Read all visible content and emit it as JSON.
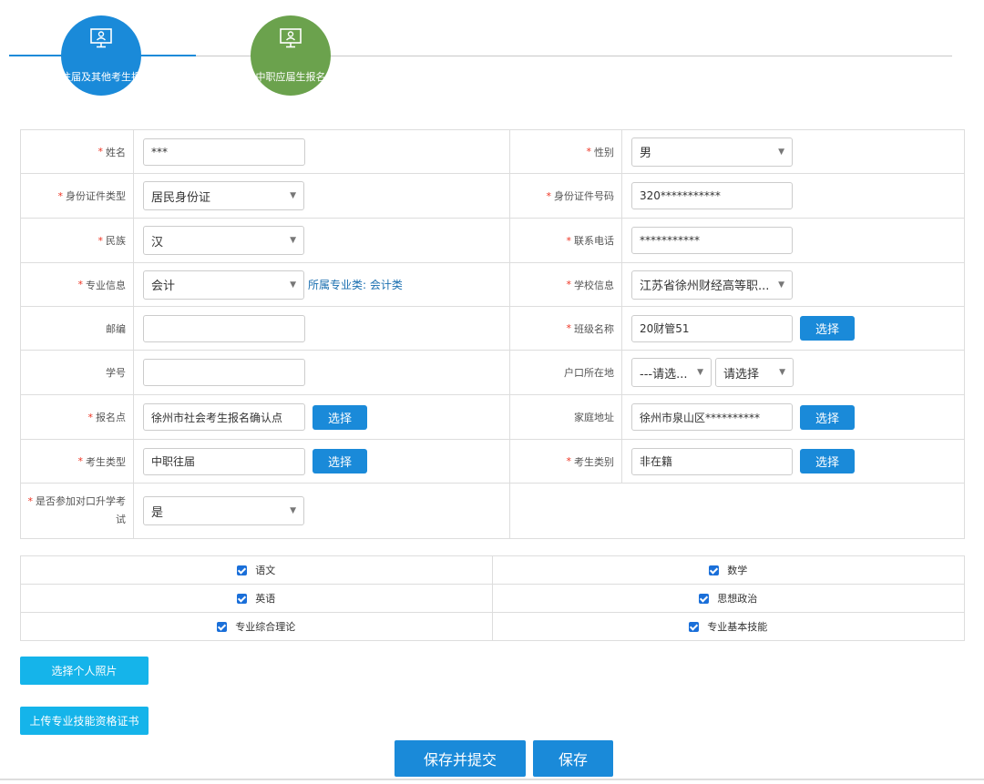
{
  "steps": [
    {
      "label": "往届及其他考生报"
    },
    {
      "label": "中职应届生报名"
    }
  ],
  "form": {
    "name": {
      "label": "姓名",
      "value": "***"
    },
    "gender": {
      "label": "性别",
      "value": "男"
    },
    "id_type": {
      "label": "身份证件类型",
      "value": "居民身份证"
    },
    "id_number": {
      "label": "身份证件号码",
      "value": "320***********"
    },
    "ethnicity": {
      "label": "民族",
      "value": "汉"
    },
    "phone": {
      "label": "联系电话",
      "value": "***********"
    },
    "major": {
      "label": "专业信息",
      "value": "会计",
      "category": "所属专业类: 会计类"
    },
    "school": {
      "label": "学校信息",
      "value": "江苏省徐州财经高等职..."
    },
    "postcode": {
      "label": "邮编",
      "value": ""
    },
    "class_name": {
      "label": "班级名称",
      "value": "20财管51",
      "button": "选择"
    },
    "student_no": {
      "label": "学号",
      "value": ""
    },
    "hukou": {
      "label": "户口所在地",
      "value1": "---请选...",
      "value2": "请选择"
    },
    "reg_point": {
      "label": "报名点",
      "value": "徐州市社会考生报名确认点",
      "button": "选择"
    },
    "address": {
      "label": "家庭地址",
      "value": "徐州市泉山区**********",
      "button": "选择"
    },
    "exam_type": {
      "label": "考生类型",
      "value": "中职往届",
      "button": "选择"
    },
    "exam_category": {
      "label": "考生类别",
      "value": "非在籍",
      "button": "选择"
    },
    "counterpart": {
      "label_line1": "是否参加对口升学考",
      "label_line2": "试",
      "value": "是"
    }
  },
  "subjects": [
    [
      "语文",
      "数学"
    ],
    [
      "英语",
      "思想政治"
    ],
    [
      "专业综合理论",
      "专业基本技能"
    ]
  ],
  "buttons": {
    "photo": "选择个人照片",
    "certificate": "上传专业技能资格证书",
    "save_submit": "保存并提交",
    "save": "保存"
  },
  "colors": {
    "primary": "#1a8ad9",
    "step2": "#6ba24d",
    "cyan": "#15b4ea",
    "required": "#e32"
  }
}
